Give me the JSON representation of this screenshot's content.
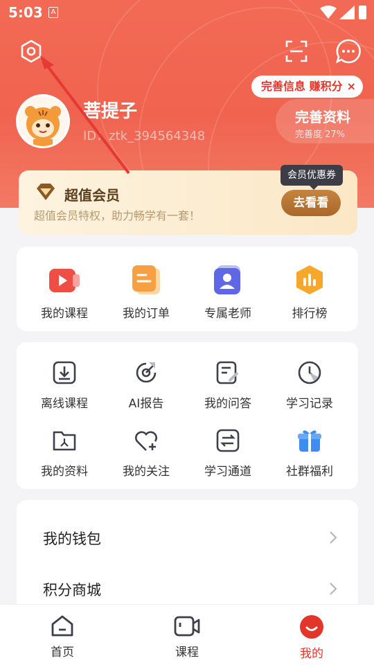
{
  "status_bar": {
    "time": "5:03",
    "notification_icon": "A"
  },
  "header": {
    "settings_icon": "settings-hex-icon",
    "scan_icon": "scan-icon",
    "message_icon": "message-icon"
  },
  "profile": {
    "name": "菩提子",
    "id_text": "ID：ztk_394564348",
    "tip": "完善信息 赚积分",
    "tip_close": "×",
    "complete_title": "完善资料",
    "complete_progress": "完善度  27%"
  },
  "vip": {
    "title": "超值会员",
    "desc": "超值会员特权，助力畅学有一套！",
    "coupon": "会员优惠券",
    "button": "去看看"
  },
  "quick_actions": [
    {
      "label": "我的课程",
      "icon": "video-course-icon"
    },
    {
      "label": "我的订单",
      "icon": "order-icon"
    },
    {
      "label": "专属老师",
      "icon": "teacher-icon"
    },
    {
      "label": "排行榜",
      "icon": "ranking-icon"
    }
  ],
  "tools": [
    {
      "label": "离线课程",
      "icon": "download-icon"
    },
    {
      "label": "AI报告",
      "icon": "ai-report-icon"
    },
    {
      "label": "我的问答",
      "icon": "qa-icon"
    },
    {
      "label": "学习记录",
      "icon": "clock-icon"
    },
    {
      "label": "我的资料",
      "icon": "folder-icon"
    },
    {
      "label": "我的关注",
      "icon": "heart-plus-icon"
    },
    {
      "label": "学习通道",
      "icon": "exchange-icon"
    },
    {
      "label": "社群福利",
      "icon": "gift-icon"
    }
  ],
  "menu": [
    {
      "label": "我的钱包"
    },
    {
      "label": "积分商城"
    }
  ],
  "tabs": [
    {
      "label": "首页",
      "icon": "home-icon"
    },
    {
      "label": "课程",
      "icon": "course-video-icon"
    },
    {
      "label": "我的",
      "icon": "profile-smile-icon",
      "active": true
    }
  ],
  "colors": {
    "brand": "#f0634f",
    "accent_red": "#e3362b",
    "vip_gold": "#b07032"
  }
}
